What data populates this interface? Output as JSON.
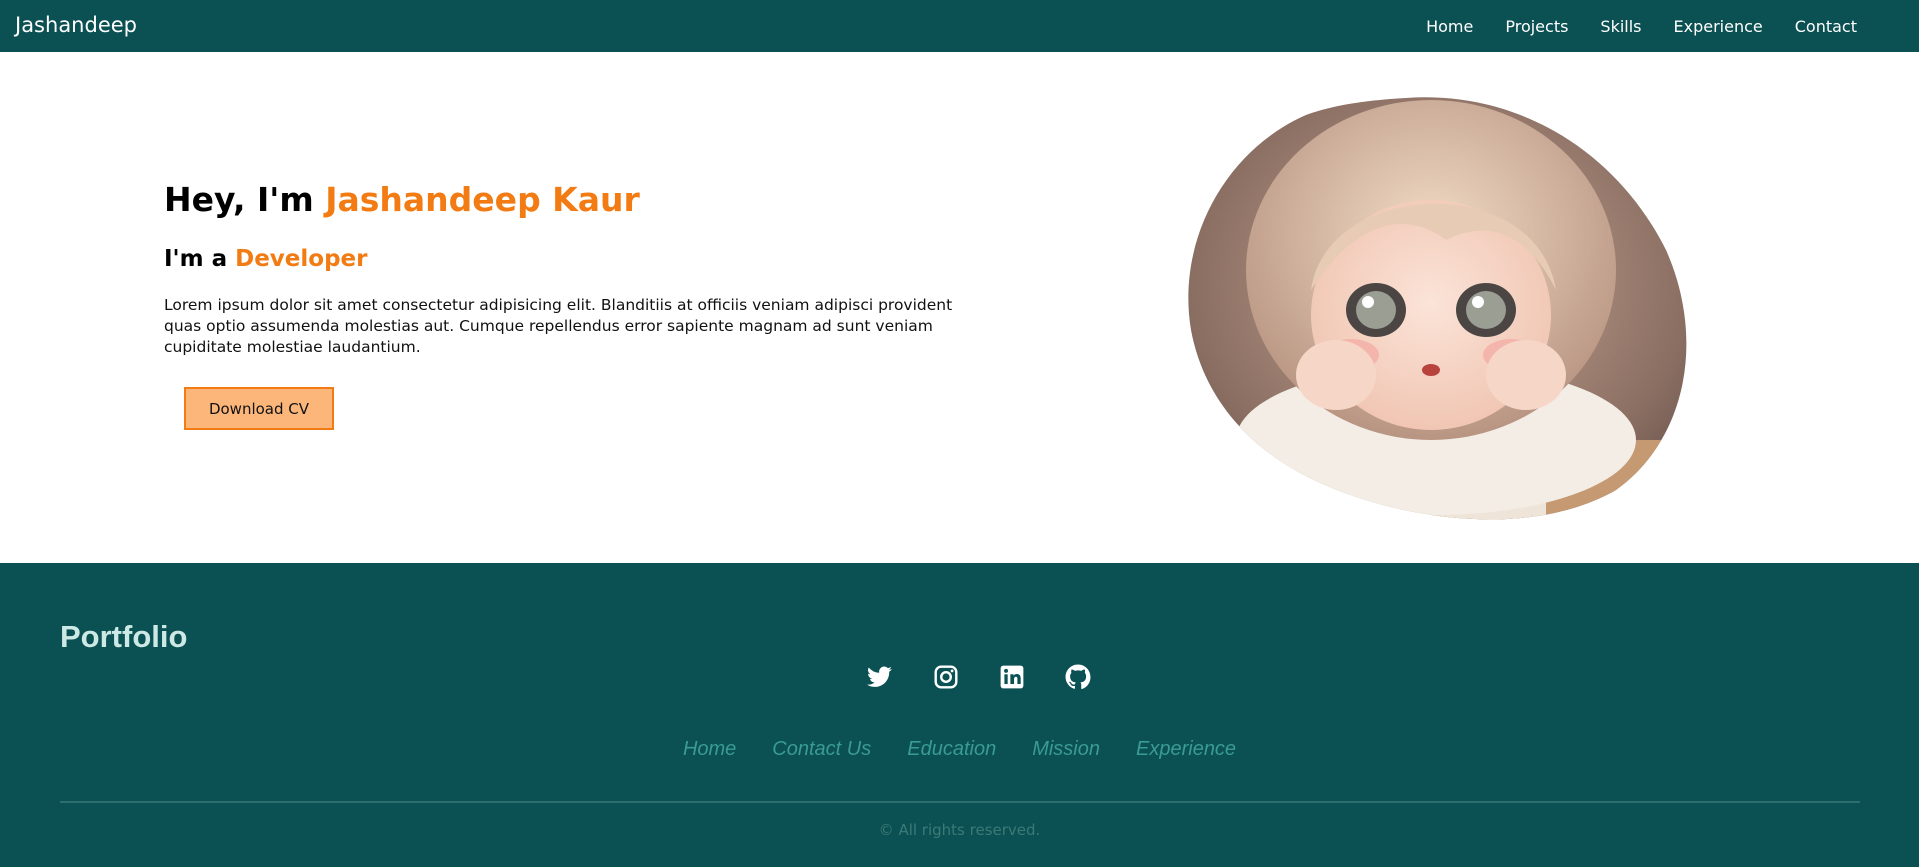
{
  "navbar": {
    "brand": "Jashandeep",
    "links": [
      "Home",
      "Projects",
      "Skills",
      "Experience",
      "Contact"
    ]
  },
  "hero": {
    "greeting_prefix": "Hey, I'm ",
    "name": "Jashandeep Kaur",
    "role_prefix": "I'm a ",
    "role": "Developer",
    "description": "Lorem ipsum dolor sit amet consectetur adipisicing elit. Blanditiis at officiis veniam adipisci provident quas optio assumenda molestias aut. Cumque repellendus error sapiente magnam ad sunt veniam cupiditate molestiae laudantium.",
    "cv_button": "Download CV",
    "image_icon": "avatar-illustration"
  },
  "footer": {
    "title": "Portfolio",
    "social_icons": [
      "twitter-icon",
      "instagram-icon",
      "linkedin-icon",
      "github-icon"
    ],
    "links": [
      "Home",
      "Contact Us",
      "Education",
      "Mission",
      "Experience"
    ],
    "copyright": "© All rights reserved."
  },
  "colors": {
    "primary": "#0b5052",
    "accent": "#f27c13",
    "button_bg": "#fdb67a",
    "footer_link": "#3a9b94",
    "footer_title": "#cde9e6"
  }
}
